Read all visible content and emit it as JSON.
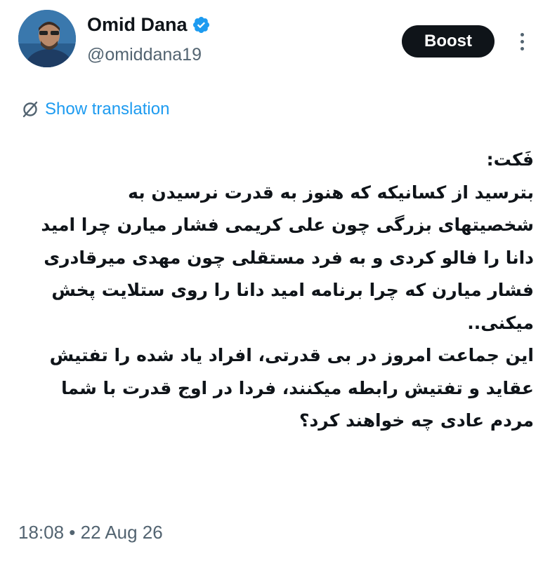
{
  "author": {
    "display_name": "Omid Dana",
    "handle": "@omiddana19",
    "verified_icon": "verified-badge-icon",
    "verified_color": "#1d9bf0"
  },
  "actions": {
    "boost_label": "Boost",
    "more_icon": "more-vertical-icon"
  },
  "translation": {
    "label": "Show translation",
    "icon": "translate-icon",
    "color": "#1d9bf0"
  },
  "tweet": {
    "lines": [
      "فَکت:",
      "بترسید از کسانیکه که هنوز به قدرت نرسیدن به",
      "شخصیتهای بزرگی چون علی کریمی فشار میارن چرا امید",
      "دانا را فالو کردی و به فرد مستقلی چون مهدی میرقادری",
      "فشار میارن که چرا برنامه امید دانا را روی ستلایت پخش",
      "میکنی..",
      "این جماعت امروز در بی قدرتی، افراد یاد شده را تفتیش",
      "عقاید و تفتیش رابطه میکنند، فردا در اوج قدرت با شما",
      "مردم عادی چه خواهند کرد؟"
    ]
  },
  "meta": {
    "timestamp": "18:08 • 22 Aug 26"
  }
}
